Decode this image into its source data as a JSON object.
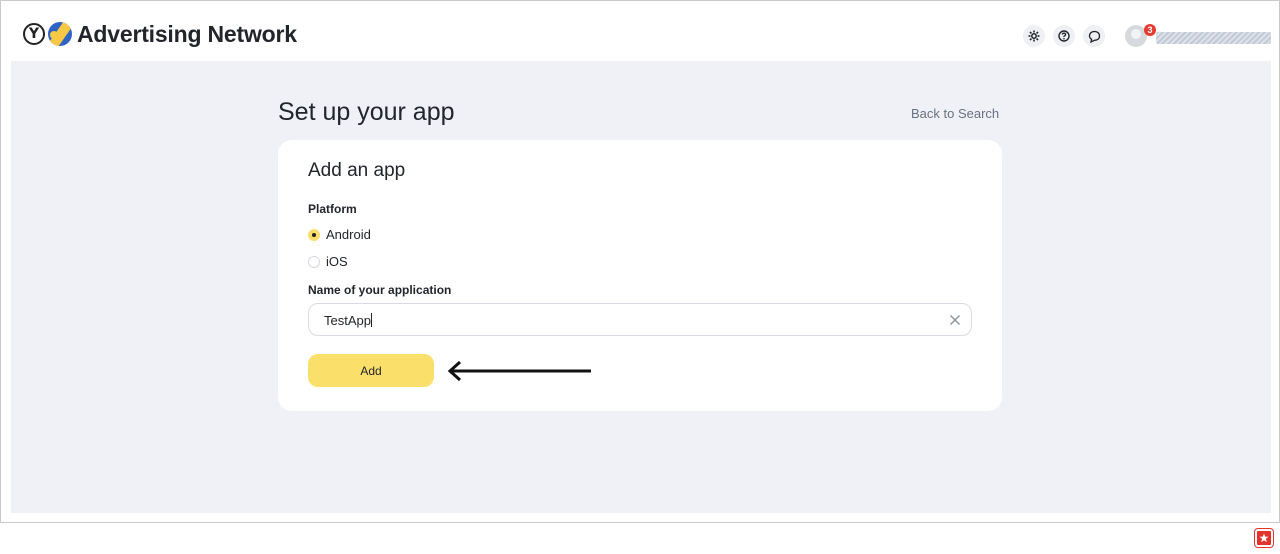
{
  "header": {
    "brand_title": "Advertising Network",
    "logo_letter": "Y",
    "icons": [
      "settings-icon",
      "help-icon",
      "chat-icon"
    ],
    "notification_count": "3"
  },
  "page": {
    "title": "Set up your app",
    "back_link": "Back to Search"
  },
  "form": {
    "title": "Add an app",
    "platform_label": "Platform",
    "platforms": [
      {
        "label": "Android",
        "selected": true
      },
      {
        "label": "iOS",
        "selected": false
      }
    ],
    "name_label": "Name of your application",
    "name_value": "TestApp",
    "add_button": "Add"
  },
  "colors": {
    "accent": "#fbdf6b",
    "background": "#eff1f6",
    "badge": "#e63b2e"
  }
}
